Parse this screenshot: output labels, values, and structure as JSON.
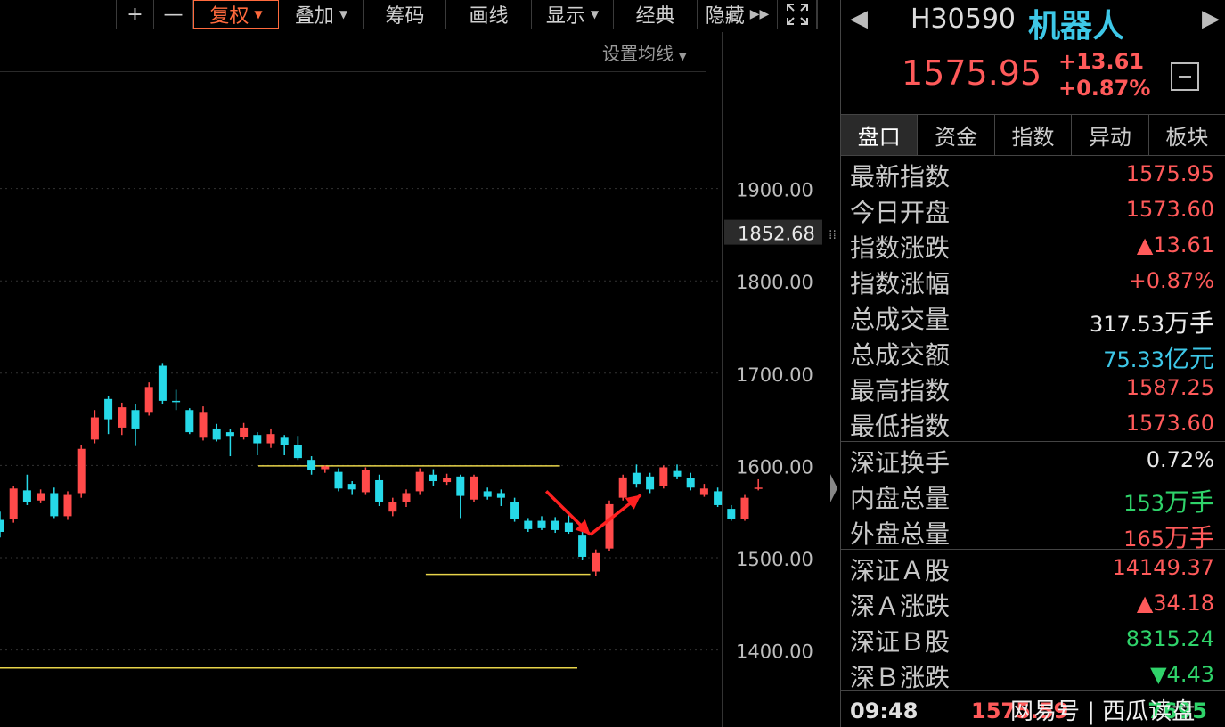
{
  "toolbar": {
    "plus": "+",
    "minus": "—",
    "fuquan": "复权",
    "diejia": "叠加",
    "chouma": "筹码",
    "huaxian": "画线",
    "xianshi": "显示",
    "jingdian": "经典",
    "yincang": "隐藏"
  },
  "ma_setting": "设置均线",
  "colors": {
    "up": "#ff4a4a",
    "down": "#26d9e8",
    "line": "#e8d44a",
    "arrow": "#ff2020"
  },
  "chart_data": {
    "type": "candlestick",
    "y_ticks": [
      "1900.00",
      "1800.00",
      "1700.00",
      "1600.00",
      "1500.00",
      "1400.00"
    ],
    "y_tick_values": [
      1900,
      1800,
      1700,
      1600,
      1500,
      1400
    ],
    "current_marker": "1852.68",
    "current_marker_value": 1852.68,
    "candles": [
      {
        "o": 1541,
        "c": 1528,
        "h": 1550,
        "l": 1522
      },
      {
        "o": 1542,
        "c": 1575,
        "h": 1578,
        "l": 1538
      },
      {
        "o": 1573,
        "c": 1560,
        "h": 1590,
        "l": 1557
      },
      {
        "o": 1562,
        "c": 1570,
        "h": 1574,
        "l": 1559
      },
      {
        "o": 1570,
        "c": 1545,
        "h": 1576,
        "l": 1543
      },
      {
        "o": 1545,
        "c": 1568,
        "h": 1572,
        "l": 1541
      },
      {
        "o": 1570,
        "c": 1618,
        "h": 1622,
        "l": 1565
      },
      {
        "o": 1628,
        "c": 1652,
        "h": 1660,
        "l": 1624
      },
      {
        "o": 1672,
        "c": 1650,
        "h": 1675,
        "l": 1634
      },
      {
        "o": 1641,
        "c": 1663,
        "h": 1668,
        "l": 1633
      },
      {
        "o": 1660,
        "c": 1640,
        "h": 1666,
        "l": 1621
      },
      {
        "o": 1658,
        "c": 1685,
        "h": 1690,
        "l": 1654
      },
      {
        "o": 1708,
        "c": 1670,
        "h": 1711,
        "l": 1666
      },
      {
        "o": 1670,
        "c": 1669,
        "h": 1682,
        "l": 1660
      },
      {
        "o": 1660,
        "c": 1636,
        "h": 1662,
        "l": 1634
      },
      {
        "o": 1630,
        "c": 1658,
        "h": 1664,
        "l": 1627
      },
      {
        "o": 1640,
        "c": 1628,
        "h": 1645,
        "l": 1626
      },
      {
        "o": 1636,
        "c": 1632,
        "h": 1639,
        "l": 1610
      },
      {
        "o": 1631,
        "c": 1641,
        "h": 1646,
        "l": 1628
      },
      {
        "o": 1633,
        "c": 1624,
        "h": 1636,
        "l": 1611
      },
      {
        "o": 1624,
        "c": 1634,
        "h": 1640,
        "l": 1619
      },
      {
        "o": 1630,
        "c": 1622,
        "h": 1633,
        "l": 1611
      },
      {
        "o": 1622,
        "c": 1608,
        "h": 1632,
        "l": 1606
      },
      {
        "o": 1606,
        "c": 1595,
        "h": 1610,
        "l": 1590
      },
      {
        "o": 1596,
        "c": 1599,
        "h": 1600,
        "l": 1592
      },
      {
        "o": 1593,
        "c": 1575,
        "h": 1597,
        "l": 1572
      },
      {
        "o": 1580,
        "c": 1574,
        "h": 1583,
        "l": 1568
      },
      {
        "o": 1571,
        "c": 1595,
        "h": 1598,
        "l": 1568
      },
      {
        "o": 1584,
        "c": 1560,
        "h": 1590,
        "l": 1556
      },
      {
        "o": 1550,
        "c": 1560,
        "h": 1565,
        "l": 1545
      },
      {
        "o": 1560,
        "c": 1570,
        "h": 1574,
        "l": 1555
      },
      {
        "o": 1572,
        "c": 1593,
        "h": 1597,
        "l": 1568
      },
      {
        "o": 1590,
        "c": 1583,
        "h": 1596,
        "l": 1578
      },
      {
        "o": 1582,
        "c": 1586,
        "h": 1591,
        "l": 1579
      },
      {
        "o": 1588,
        "c": 1567,
        "h": 1590,
        "l": 1543
      },
      {
        "o": 1563,
        "c": 1588,
        "h": 1590,
        "l": 1560
      },
      {
        "o": 1572,
        "c": 1566,
        "h": 1576,
        "l": 1563
      },
      {
        "o": 1570,
        "c": 1565,
        "h": 1574,
        "l": 1556
      },
      {
        "o": 1560,
        "c": 1542,
        "h": 1565,
        "l": 1539
      },
      {
        "o": 1540,
        "c": 1531,
        "h": 1543,
        "l": 1528
      },
      {
        "o": 1540,
        "c": 1532,
        "h": 1545,
        "l": 1530
      },
      {
        "o": 1540,
        "c": 1530,
        "h": 1544,
        "l": 1527
      },
      {
        "o": 1538,
        "c": 1528,
        "h": 1550,
        "l": 1526
      },
      {
        "o": 1524,
        "c": 1501,
        "h": 1528,
        "l": 1498
      },
      {
        "o": 1485,
        "c": 1505,
        "h": 1509,
        "l": 1480
      },
      {
        "o": 1510,
        "c": 1558,
        "h": 1562,
        "l": 1507
      },
      {
        "o": 1565,
        "c": 1587,
        "h": 1590,
        "l": 1562
      },
      {
        "o": 1592,
        "c": 1580,
        "h": 1601,
        "l": 1576
      },
      {
        "o": 1588,
        "c": 1574,
        "h": 1592,
        "l": 1570
      },
      {
        "o": 1578,
        "c": 1598,
        "h": 1600,
        "l": 1575
      },
      {
        "o": 1594,
        "c": 1588,
        "h": 1601,
        "l": 1585
      },
      {
        "o": 1586,
        "c": 1576,
        "h": 1592,
        "l": 1573
      },
      {
        "o": 1568,
        "c": 1575,
        "h": 1580,
        "l": 1566
      },
      {
        "o": 1572,
        "c": 1557,
        "h": 1576,
        "l": 1555
      },
      {
        "o": 1553,
        "c": 1542,
        "h": 1557,
        "l": 1540
      },
      {
        "o": 1542,
        "c": 1565,
        "h": 1568,
        "l": 1540
      },
      {
        "o": 1575,
        "c": 1576,
        "h": 1585,
        "l": 1573
      }
    ],
    "hlines": [
      {
        "y": 1599.5,
        "x1": 0.358,
        "x2": 0.776
      },
      {
        "y": 1482,
        "x1": 0.59,
        "x2": 0.818
      },
      {
        "y": 1380.5,
        "x1": 0.0,
        "x2": 0.8
      }
    ],
    "arrows": [
      {
        "from": [
          0.757,
          1572
        ],
        "to": [
          0.818,
          1525
        ]
      },
      {
        "from": [
          0.818,
          1525
        ],
        "to": [
          0.888,
          1568
        ]
      }
    ]
  },
  "panel": {
    "code": "H30590",
    "name": "机器人",
    "price": "1575.95",
    "change": "+13.61",
    "change_pct": "+0.87%",
    "tabs": [
      "盘口",
      "资金",
      "指数",
      "异动",
      "板块"
    ],
    "rows": [
      {
        "label": "最新指数",
        "value": "1575.95",
        "unit": "",
        "color": "red"
      },
      {
        "label": "今日开盘",
        "value": "1573.60",
        "unit": "",
        "color": "red"
      },
      {
        "label": "指数涨跌",
        "value": "▲13.61",
        "unit": "",
        "color": "red"
      },
      {
        "label": "指数涨幅",
        "value": "+0.87%",
        "unit": "",
        "color": "red"
      },
      {
        "label": "总成交量",
        "value": "317.53",
        "unit": "万手",
        "color": "white"
      },
      {
        "label": "总成交额",
        "value": "75.33",
        "unit": "亿元",
        "color": "cyan"
      },
      {
        "label": "最高指数",
        "value": "1587.25",
        "unit": "",
        "color": "red"
      },
      {
        "label": "最低指数",
        "value": "1573.60",
        "unit": "",
        "color": "red"
      }
    ],
    "rows2": [
      {
        "label": "深证换手",
        "value": "0.72%",
        "unit": "",
        "color": "white"
      },
      {
        "label": "内盘总量",
        "value": "153",
        "unit": "万手",
        "color": "green"
      },
      {
        "label": "外盘总量",
        "value": "165",
        "unit": "万手",
        "color": "red"
      }
    ],
    "rows3": [
      {
        "label": "深证Ａ股",
        "value": "14149.37",
        "unit": "",
        "color": "red"
      },
      {
        "label": "深Ａ涨跌",
        "value": "▲34.18",
        "unit": "",
        "color": "red"
      },
      {
        "label": "深证Ｂ股",
        "value": "8315.24",
        "unit": "",
        "color": "green"
      },
      {
        "label": "深Ｂ涨跌",
        "value": "▼4.43",
        "unit": "",
        "color": "green"
      }
    ],
    "footer": {
      "time": "09:48",
      "price": "1575.59",
      "vol": "7695"
    },
    "watermark": "网易号 | 西瓜读盘"
  }
}
